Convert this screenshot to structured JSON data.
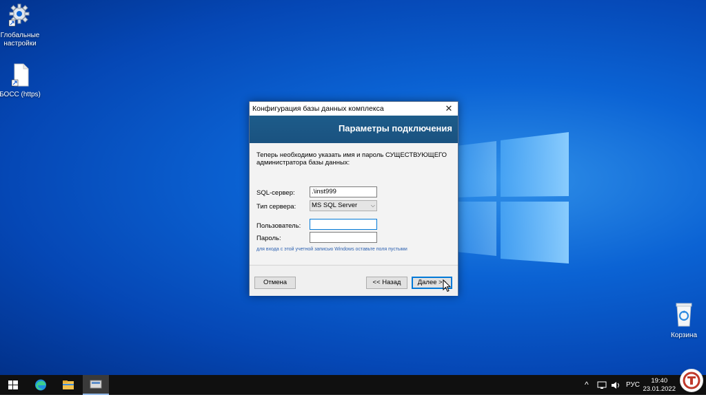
{
  "desktop": {
    "icons": [
      {
        "label_line1": "Глобальные",
        "label_line2": "настройки",
        "icon": "gear-shortcut-icon"
      },
      {
        "label_line1": "БОСС (https)",
        "label_line2": "",
        "icon": "document-shortcut-icon"
      },
      {
        "label_line1": "Корзина",
        "label_line2": "",
        "icon": "recycle-bin-icon"
      }
    ]
  },
  "dialog": {
    "title": "Конфигурация базы данных комплекса",
    "close_glyph": "✕",
    "banner_title": "Параметры подключения",
    "intro": "Теперь необходимо указать имя и пароль СУЩЕСТВУЮЩЕГО администратора базы данных:",
    "fields": {
      "sql_server_label": "SQL-сервер:",
      "sql_server_value": ".\\inst999",
      "server_type_label": "Тип сервера:",
      "server_type_value": "MS SQL Server",
      "user_label": "Пользователь:",
      "user_value": "",
      "password_label": "Пароль:",
      "password_value": ""
    },
    "hint": "для входа с этой учетной записью Windows оставьте поля пустыми",
    "buttons": {
      "cancel": "Отмена",
      "back": "<< Назад",
      "next": "Далее >>"
    }
  },
  "taskbar": {
    "apps": [
      "windows-start-icon",
      "edge-icon",
      "file-explorer-icon",
      "setup-app-icon"
    ],
    "tray": {
      "chevron": "^",
      "language": "РУС"
    },
    "clock": {
      "time": "19:40",
      "date": "23.01.2022"
    }
  },
  "colors": {
    "desktop_blue": "#0b63d4",
    "banner": "#1d5c8a",
    "focus": "#0078d7",
    "hint": "#2a5fb0"
  }
}
